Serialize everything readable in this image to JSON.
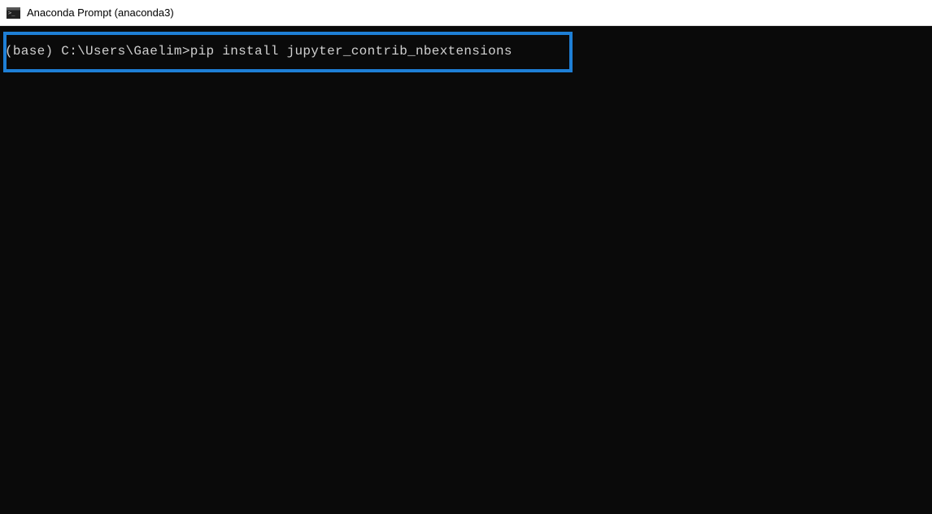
{
  "window": {
    "title": "Anaconda Prompt (anaconda3)"
  },
  "terminal": {
    "prompt": "(base) C:\\Users\\Gaelim>",
    "command": "pip install jupyter_contrib_nbextensions"
  }
}
